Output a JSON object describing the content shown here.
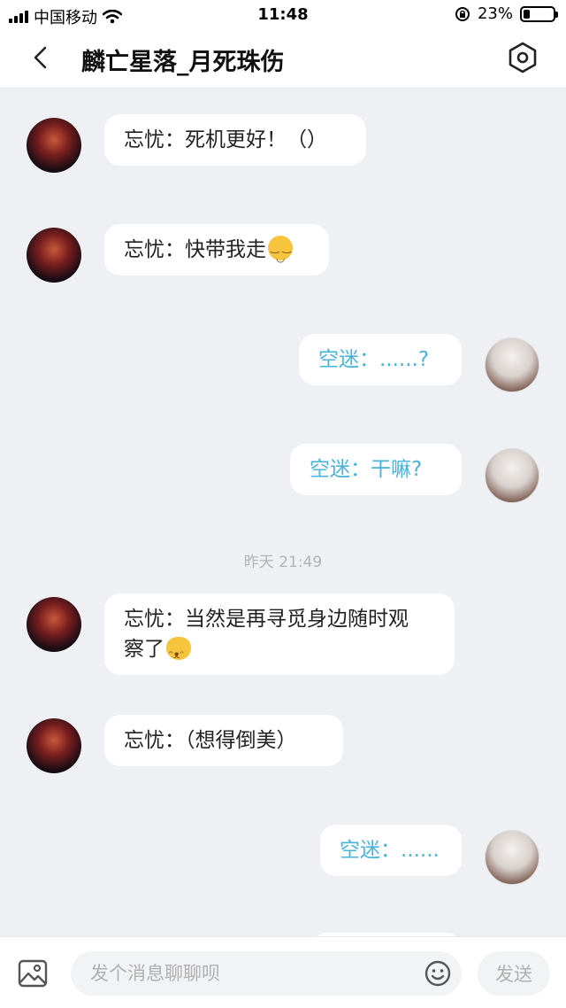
{
  "status_bar": {
    "carrier": "中国移动",
    "time": "11:48",
    "battery_percent": "23%",
    "battery_level": 0.23
  },
  "header": {
    "title": "麟亡星落_月死珠伤",
    "back_icon": "chevron-left-icon",
    "settings_icon": "hexagon-settings-icon"
  },
  "messages": [
    {
      "side": "left",
      "text": "忘忧：死机更好！（）"
    },
    {
      "side": "left",
      "text": "忘忧：快带我走",
      "emoji": "smile-emoji"
    },
    {
      "side": "right",
      "text": "空迷：......?"
    },
    {
      "side": "right",
      "text": "空迷：干嘛?"
    },
    {
      "side": "timestamp",
      "text": "昨天 21:49"
    },
    {
      "side": "left",
      "text": "忘忧：当然是再寻觅身边随时观",
      "text_line2": "察了",
      "emoji": "cat-emoji"
    },
    {
      "side": "left",
      "text": "忘忧：（想得倒美）"
    },
    {
      "side": "right",
      "text": "空迷：......"
    }
  ],
  "input_bar": {
    "placeholder": "发个消息聊聊呗",
    "send_label": "发送",
    "image_icon": "image-icon",
    "emoji_icon": "emoji-icon"
  },
  "colors": {
    "background": "#eef0f3",
    "bubble": "#ffffff",
    "right_text": "#4ab3d8",
    "left_text": "#222222",
    "timestamp": "#b3b3b3"
  }
}
